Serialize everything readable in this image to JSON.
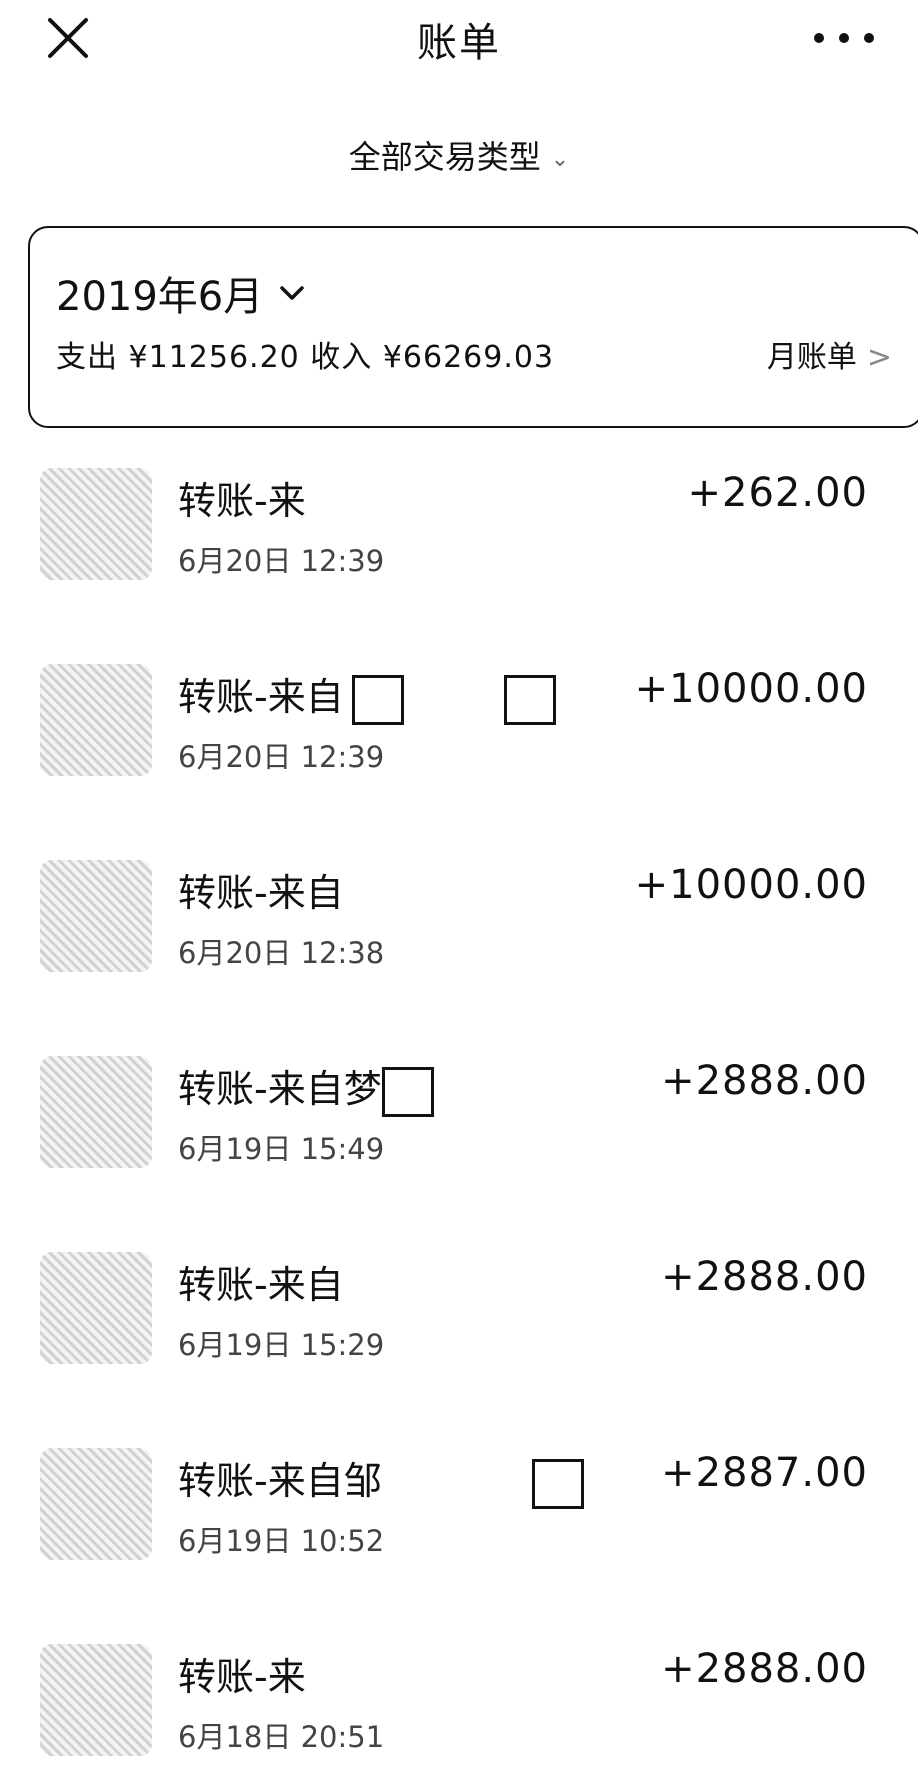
{
  "header": {
    "title": "账单",
    "close_icon": "close-icon",
    "more_icon": "more-horizontal-icon"
  },
  "filter": {
    "label": "全部交易类型",
    "chevron": "⌄"
  },
  "month_card": {
    "title": "2019年6月",
    "summary": "支出 ¥11256.20 收入 ¥66269.03",
    "monthly_link": "月账单",
    "monthly_arrow": ">"
  },
  "transactions": [
    {
      "title": "转账-来",
      "time": "6月20日 12:39",
      "amount": "+262.00"
    },
    {
      "title": "转账-来自",
      "time": "6月20日 12:39",
      "amount": "+10000.00"
    },
    {
      "title": "转账-来自",
      "time": "6月20日 12:38",
      "amount": "+10000.00"
    },
    {
      "title": "转账-来自梦",
      "time": "6月19日 15:49",
      "amount": "+2888.00"
    },
    {
      "title": "转账-来自",
      "time": "6月19日 15:29",
      "amount": "+2888.00"
    },
    {
      "title": "转账-来自邹",
      "time": "6月19日 10:52",
      "amount": "+2887.00"
    },
    {
      "title": "转账-来",
      "time": "6月18日 20:51",
      "amount": "+2888.00"
    }
  ]
}
